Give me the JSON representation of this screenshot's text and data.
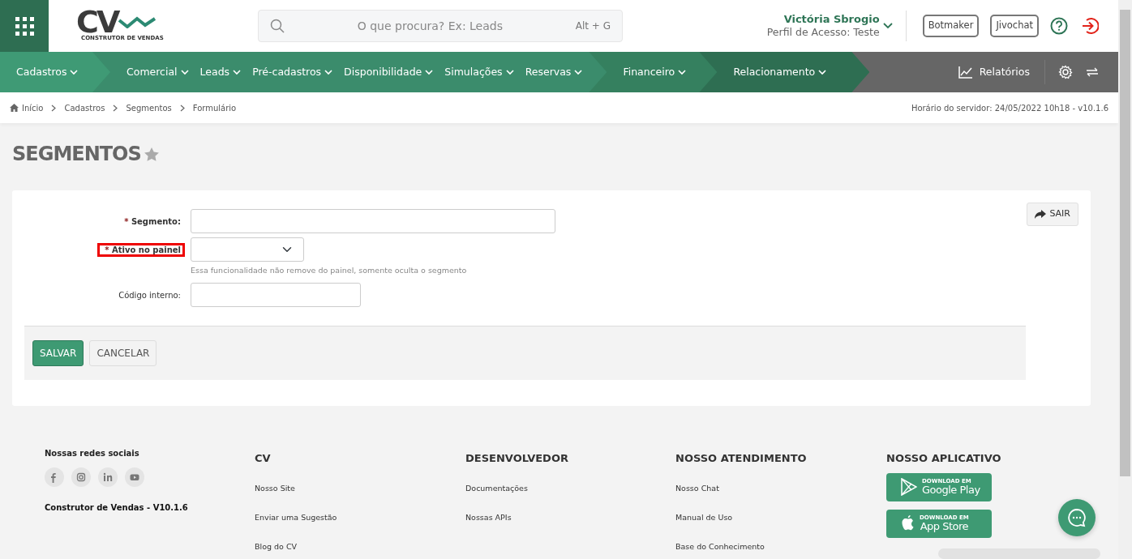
{
  "header": {
    "logo": {
      "mark": "CV",
      "tagline": "CONSTRUTOR DE VENDAS"
    },
    "search": {
      "placeholder": "O que procura? Ex: Leads",
      "shortcut": "Alt + G"
    },
    "user": {
      "name": "Victória Sbrogio",
      "profile": "Perfil de Acesso: Teste"
    },
    "buttons": [
      "Botmaker",
      "Jivochat"
    ]
  },
  "nav": {
    "groups": [
      {
        "items": [
          "Cadastros"
        ]
      },
      {
        "items": [
          "Comercial",
          "Leads",
          "Pré-cadastros",
          "Disponibilidade",
          "Simulações",
          "Reservas"
        ]
      },
      {
        "items": [
          "Financeiro"
        ]
      },
      {
        "items": [
          "Relacionamento"
        ]
      }
    ],
    "reports": "Relatórios"
  },
  "breadcrumb": [
    "Início",
    "Cadastros",
    "Segmentos",
    "Formulário"
  ],
  "server_time": "Horário do servidor: 24/05/2022 10h18 - v10.1.6",
  "page_title": "SEGMENTOS",
  "favorite": false,
  "form": {
    "fields": [
      {
        "kind": "text",
        "required_mark": "*",
        "label": "Segmento:",
        "highlighted": false
      },
      {
        "kind": "select",
        "required_mark": "*",
        "label": "Ativo no painel",
        "highlighted": true,
        "help": "Essa funcionalidade não remove do painel, somente oculta o segmento"
      },
      {
        "kind": "text",
        "label": "Código interno:",
        "highlighted": false
      }
    ],
    "exit_button": "SAIR",
    "save_button": "SALVAR",
    "cancel_button": "CANCELAR"
  },
  "footer": {
    "social": {
      "title": "Nossas redes sociais",
      "version": "Construtor de Vendas - V10.1.6"
    },
    "columns": [
      {
        "title": "CV",
        "links": [
          "Nosso Site",
          "Enviar uma Sugestão",
          "Blog do CV"
        ]
      },
      {
        "title": "DESENVOLVEDOR",
        "links": [
          "Documentações",
          "Nossas APIs"
        ]
      },
      {
        "title": "NOSSO ATENDIMENTO",
        "links": [
          "Nosso Chat",
          "Manual de Uso",
          "Base do Conhecimento"
        ]
      }
    ],
    "app": {
      "title": "NOSSO APLICATIVO",
      "stores": [
        {
          "kind": "google",
          "small": "DOWNLOAD EM",
          "name": "Google Play"
        },
        {
          "kind": "apple",
          "small": "DOWNLOAD EM",
          "name": "App Store"
        }
      ]
    }
  }
}
